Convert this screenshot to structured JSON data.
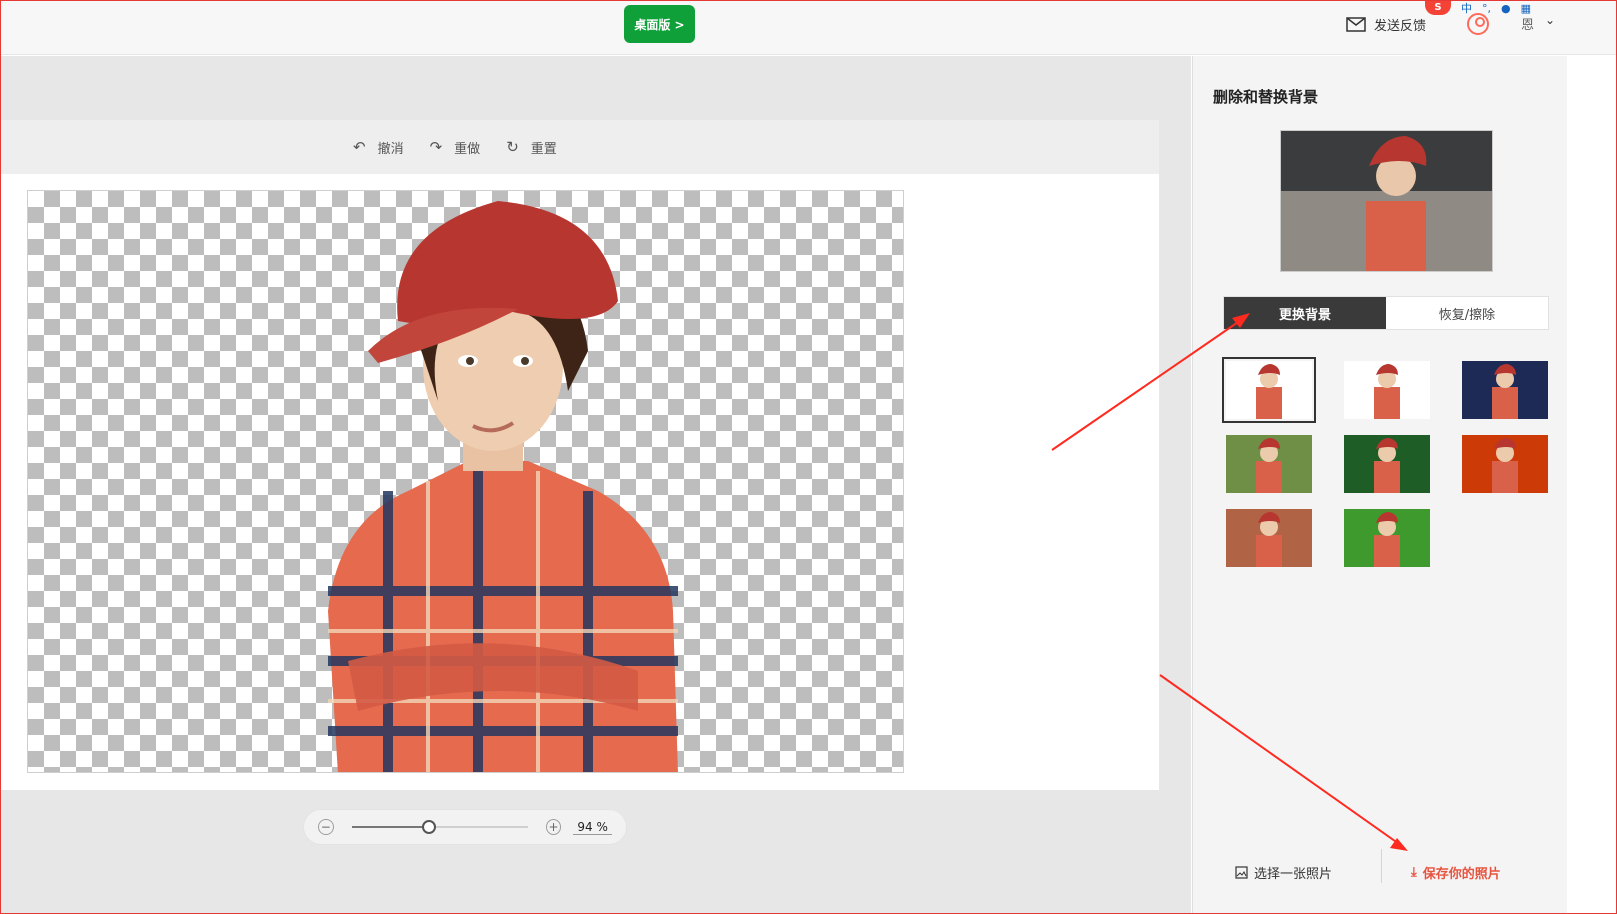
{
  "topbar": {
    "desktop_label": "桌面版 >",
    "feedback_label": "发送反馈",
    "username": "恩",
    "ime_label": "中",
    "ime_logo": "S"
  },
  "toolbar": {
    "undo_label": "撤消",
    "redo_label": "重做",
    "reset_label": "重置"
  },
  "zoom": {
    "value": "94",
    "unit": "%",
    "level_fraction": 0.44
  },
  "panel": {
    "title": "删除和替换背景",
    "tabs": [
      {
        "label": "更换背景",
        "active": true
      },
      {
        "label": "恢复/擦除",
        "active": false
      }
    ],
    "backgrounds": [
      {
        "name": "white-bordered",
        "color": "#ffffff",
        "selected": true
      },
      {
        "name": "white",
        "color": "#ffffff",
        "selected": false
      },
      {
        "name": "starry-night",
        "color": "#1c2a55",
        "selected": false
      },
      {
        "name": "grass-field",
        "color": "#6f8f46",
        "selected": false
      },
      {
        "name": "green-leaves",
        "color": "#1f5d26",
        "selected": false
      },
      {
        "name": "fire",
        "color": "#cc3a08",
        "selected": false
      },
      {
        "name": "brick-wall",
        "color": "#b06345",
        "selected": false
      },
      {
        "name": "green-lawn",
        "color": "#3f9a2d",
        "selected": false
      }
    ],
    "choose_label": "选择一张照片",
    "save_label": "保存你的照片"
  },
  "colors": {
    "accent_green": "#10a03a",
    "save_red": "#e8533f",
    "annotation_red": "#ff2a1f"
  }
}
